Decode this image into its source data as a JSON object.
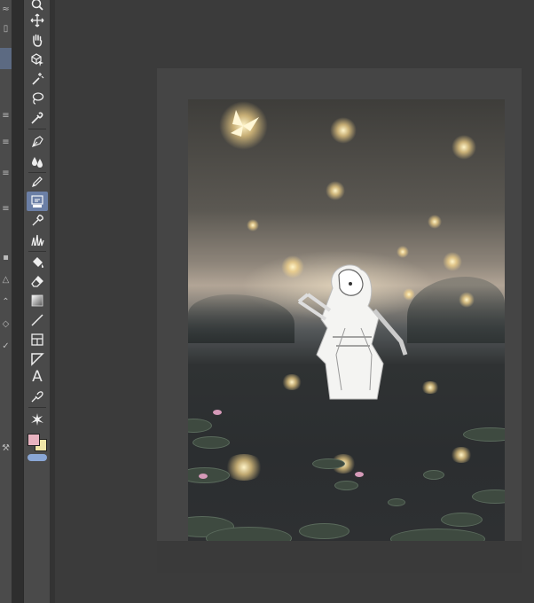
{
  "toolbar": {
    "tools": [
      {
        "name": "zoom-tool",
        "icon": "magnifier-icon"
      },
      {
        "name": "move-tool",
        "icon": "move-arrows-icon"
      },
      {
        "name": "hand-tool",
        "icon": "hand-icon"
      },
      {
        "name": "object-select-tool",
        "icon": "cube-cursor-icon"
      },
      {
        "name": "auto-select-tool",
        "icon": "magic-wand-icon"
      },
      {
        "name": "lasso-tool",
        "icon": "lasso-icon"
      },
      {
        "name": "eyedropper-tool",
        "icon": "eyedropper-icon"
      },
      {
        "name": "pen-tool",
        "icon": "pen-nib-icon"
      },
      {
        "name": "blend-tool",
        "icon": "droplets-icon"
      },
      {
        "name": "pencil-tool",
        "icon": "pencil-icon"
      },
      {
        "name": "brush-tool",
        "icon": "brush-icon",
        "active": true
      },
      {
        "name": "airbrush-tool",
        "icon": "airbrush-icon"
      },
      {
        "name": "decoration-tool",
        "icon": "grass-icon"
      },
      {
        "name": "fill-tool",
        "icon": "bucket-icon"
      },
      {
        "name": "eraser-tool",
        "icon": "eraser-icon"
      },
      {
        "name": "gradient-tool",
        "icon": "gradient-icon"
      },
      {
        "name": "line-tool",
        "icon": "line-icon"
      },
      {
        "name": "frame-tool",
        "icon": "frame-grid-icon"
      },
      {
        "name": "ruler-tool",
        "icon": "ruler-icon"
      },
      {
        "name": "text-tool",
        "icon": "text-icon",
        "label": "A"
      },
      {
        "name": "correct-line-tool",
        "icon": "correct-line-icon"
      },
      {
        "name": "effect-tool",
        "icon": "sparkle-icon"
      }
    ],
    "main_color": "#e8b3c0",
    "sub_color": "#f0e6a8"
  },
  "left_panel": {
    "selected_color": "#5c6a82"
  }
}
